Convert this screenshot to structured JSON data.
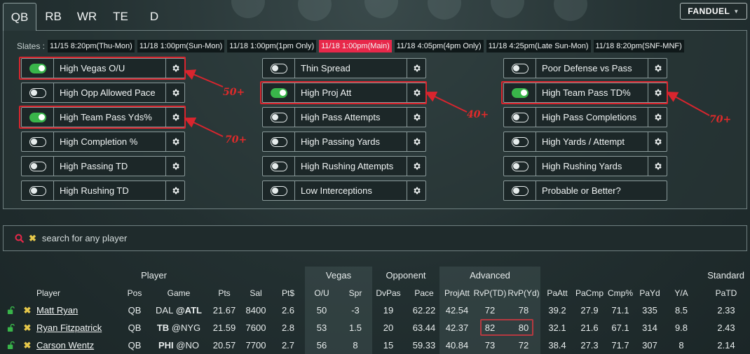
{
  "tabs": [
    "QB",
    "RB",
    "WR",
    "TE",
    "D"
  ],
  "brand": "FANDUEL",
  "slates_label": "Slates :",
  "slates": [
    {
      "label": "11/15 8:20pm(Thu-Mon)",
      "active": false
    },
    {
      "label": "11/18 1:00pm(Sun-Mon)",
      "active": false
    },
    {
      "label": "11/18 1:00pm(1pm Only)",
      "active": false
    },
    {
      "label": "11/18 1:00pm(Main)",
      "active": true
    },
    {
      "label": "11/18 4:05pm(4pm Only)",
      "active": false
    },
    {
      "label": "11/18 4:25pm(Late Sun-Mon)",
      "active": false
    },
    {
      "label": "11/18 8:20pm(SNF-MNF)",
      "active": false
    }
  ],
  "filters": {
    "col1": [
      {
        "label": "High Vegas O/U",
        "on": true
      },
      {
        "label": "High Opp Allowed Pace",
        "on": false
      },
      {
        "label": "High Team Pass Yds%",
        "on": true
      },
      {
        "label": "High Completion %",
        "on": false
      },
      {
        "label": "High Passing TD",
        "on": false
      },
      {
        "label": "High Rushing TD",
        "on": false
      }
    ],
    "col2": [
      {
        "label": "Thin Spread",
        "on": false
      },
      {
        "label": "High Proj Att",
        "on": true
      },
      {
        "label": "High Pass Attempts",
        "on": false
      },
      {
        "label": "High Passing Yards",
        "on": false
      },
      {
        "label": "High Rushing Attempts",
        "on": false
      },
      {
        "label": "Low Interceptions",
        "on": false
      }
    ],
    "col3": [
      {
        "label": "Poor Defense vs Pass",
        "on": false
      },
      {
        "label": "High Team Pass TD%",
        "on": true
      },
      {
        "label": "High Pass Completions",
        "on": false
      },
      {
        "label": "High Yards / Attempt",
        "on": false
      },
      {
        "label": "High Rushing Yards",
        "on": false
      },
      {
        "label": "Probable or Better?",
        "on": false
      }
    ]
  },
  "annotations": [
    "50+",
    "70+",
    "40+",
    "70+"
  ],
  "search": {
    "placeholder": "search for any player"
  },
  "table": {
    "groups": [
      "Player",
      "Vegas",
      "Opponent",
      "Advanced",
      "Standard"
    ],
    "headers": [
      "Player",
      "Pos",
      "Game",
      "Pts",
      "Sal",
      "Pt$",
      "O/U",
      "Spr",
      "DvPas",
      "Pace",
      "ProjAtt",
      "RvP(TD)",
      "RvP(Yd)",
      "PaAtt",
      "PaCmp",
      "Cmp%",
      "PaYd",
      "Y/A",
      "PaTD"
    ],
    "rows": [
      {
        "name": "Matt Ryan",
        "pos": "QB",
        "team": "DAL",
        "opp": "@ATL",
        "team_bold": false,
        "opp_bold": true,
        "vals": [
          "21.67",
          "8400",
          "2.6",
          "50",
          "-3",
          "19",
          "62.22",
          "42.54",
          "72",
          "78",
          "39.2",
          "27.9",
          "71.1",
          "335",
          "8.5",
          "2.33"
        ]
      },
      {
        "name": "Ryan Fitzpatrick",
        "pos": "QB",
        "team": "TB",
        "opp": "@NYG",
        "team_bold": true,
        "opp_bold": false,
        "vals": [
          "21.59",
          "7600",
          "2.8",
          "53",
          "1.5",
          "20",
          "63.44",
          "42.37",
          "82",
          "80",
          "32.1",
          "21.6",
          "67.1",
          "314",
          "9.8",
          "2.43"
        ]
      },
      {
        "name": "Carson Wentz",
        "pos": "QB",
        "team": "PHI",
        "opp": "@NO",
        "team_bold": true,
        "opp_bold": false,
        "vals": [
          "20.57",
          "7700",
          "2.7",
          "56",
          "8",
          "15",
          "59.33",
          "40.84",
          "73",
          "72",
          "38.4",
          "27.3",
          "71.7",
          "307",
          "8",
          "2.14"
        ]
      }
    ]
  },
  "colors": {
    "toggle_on": "#39b54a",
    "active_slate": "#e8284a",
    "highlight": "#d9252e",
    "lock": "#39b54a",
    "remove": "#e6c84a"
  }
}
